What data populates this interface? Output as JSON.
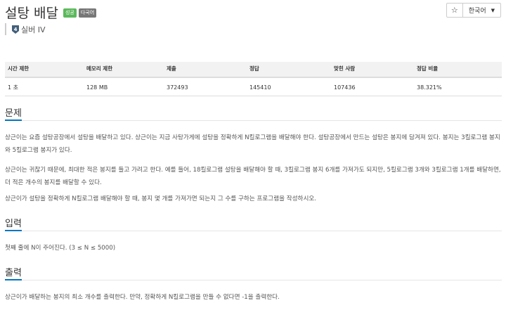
{
  "problem": {
    "title": "설탕 배달",
    "badges": [
      "성공",
      "다국어"
    ],
    "tier": "실버 IV",
    "tier_number": "4"
  },
  "header_actions": {
    "star_icon": "star-icon",
    "language": "한국어"
  },
  "stats": {
    "headers": [
      "시간 제한",
      "메모리 제한",
      "제출",
      "정답",
      "맞힌 사람",
      "정답 비율"
    ],
    "values": [
      "1 초",
      "128 MB",
      "372493",
      "145410",
      "107436",
      "38.321%"
    ]
  },
  "sections": {
    "problem_title": "문제",
    "problem_p1": "상근이는 요즘 설탕공장에서 설탕을 배달하고 있다. 상근이는 지금 사탕가게에 설탕을 정확하게 N킬로그램을 배달해야 한다. 설탕공장에서 만드는 설탕은 봉지에 담겨져 있다. 봉지는 3킬로그램 봉지와 5킬로그램 봉지가 있다.",
    "problem_p2": "상근이는 귀찮기 때문에, 최대한 적은 봉지를 들고 가려고 한다. 예를 들어, 18킬로그램 설탕을 배달해야 할 때, 3킬로그램 봉지 6개를 가져가도 되지만, 5킬로그램 3개와 3킬로그램 1개를 배달하면, 더 적은 개수의 봉지를 배달할 수 있다.",
    "problem_p3": "상근이가 설탕을 정확하게 N킬로그램 배달해야 할 때, 봉지 몇 개를 가져가면 되는지 그 수를 구하는 프로그램을 작성하시오.",
    "input_title": "입력",
    "input_p1": "첫째 줄에 N이 주어진다. (3 ≤ N ≤ 5000)",
    "output_title": "출력",
    "output_p1": "상근이가 배달하는 봉지의 최소 개수를 출력한다. 만약, 정확하게 N킬로그램을 만들 수 없다면 -1을 출력한다."
  },
  "colors": {
    "badge_success": "#5cb85c",
    "badge_multilang": "#777777",
    "section_accent": "#0076c0"
  }
}
